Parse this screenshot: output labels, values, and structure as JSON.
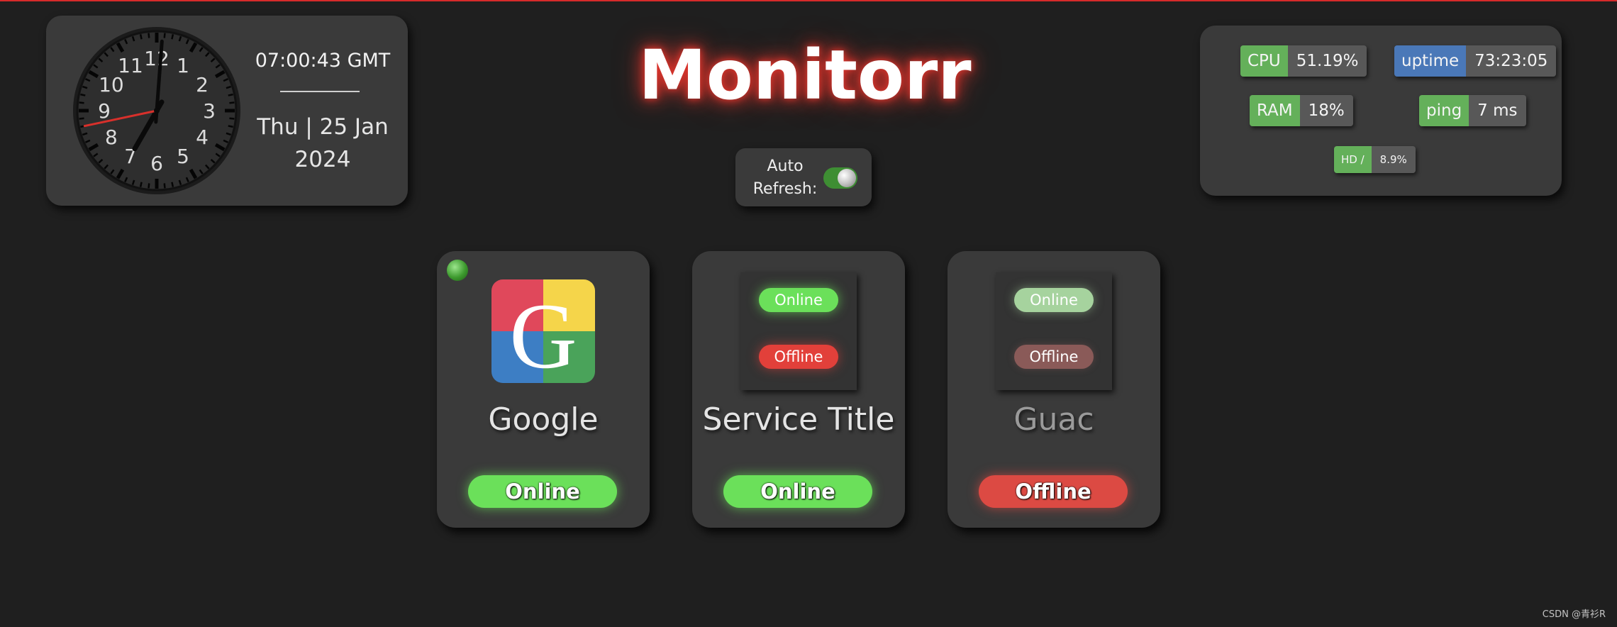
{
  "colors": {
    "accent_red": "#e0352d",
    "online_green": "#6be05a",
    "offline_red": "#dc4a43",
    "stat_green": "#64b05a",
    "stat_blue": "#4a78b8",
    "panel_bg": "#3a3a3a",
    "page_bg": "#1f1f1f"
  },
  "app": {
    "title": "Monitorr"
  },
  "clock": {
    "time": "07:00:43 GMT",
    "date_line1": "Thu | 25 Jan",
    "date_line2": "2024",
    "hour": 7,
    "minute": 0,
    "second": 43,
    "numerals": [
      "12",
      "1",
      "2",
      "3",
      "4",
      "5",
      "6",
      "7",
      "8",
      "9",
      "10",
      "11"
    ]
  },
  "auto_refresh": {
    "label_line1": "Auto",
    "label_line2": "Refresh:",
    "enabled": true
  },
  "stats": {
    "cpu": {
      "label": "CPU",
      "value": "51.19%"
    },
    "uptime": {
      "label": "uptime",
      "value": "73:23:05"
    },
    "ram": {
      "label": "RAM",
      "value": "18%"
    },
    "ping": {
      "label": "ping",
      "value": "7 ms"
    },
    "hd": {
      "label": "HD /",
      "value": "8.9%"
    }
  },
  "services": [
    {
      "title": "Google",
      "status": "Online",
      "icon": "google-g-icon"
    },
    {
      "title": "Service Title",
      "status": "Online",
      "icon": "status-placeholder-image",
      "pill_online": "Online",
      "pill_offline": "Offline"
    },
    {
      "title": "Guac",
      "status": "Offline",
      "icon": "status-placeholder-image",
      "pill_online": "Online",
      "pill_offline": "Offline"
    }
  ],
  "watermark": "CSDN @青衫R"
}
